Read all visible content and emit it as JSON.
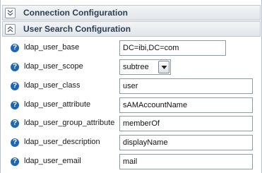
{
  "sections": {
    "connection": {
      "title": "Connection Configuration",
      "state": "collapsed",
      "icon": "chevron-double-down-icon"
    },
    "user_search": {
      "title": "User Search Configuration",
      "state": "expanded",
      "icon": "chevron-double-up-icon"
    }
  },
  "help_icon": {
    "glyph": "?",
    "name": "help-icon"
  },
  "fields": [
    {
      "label": "ldap_user_base",
      "value": "DC=ibi,DC=com"
    },
    {
      "label": "ldap_user_scope",
      "value": "subtree"
    },
    {
      "label": "ldap_user_class",
      "value": "user"
    },
    {
      "label": "ldap_user_attribute",
      "value": "sAMAccountName"
    },
    {
      "label": "ldap_user_group_attribute",
      "value": "memberOf"
    },
    {
      "label": "ldap_user_description",
      "value": "displayName"
    },
    {
      "label": "ldap_user_email",
      "value": "mail"
    }
  ],
  "colors": {
    "header_title": "#2a3e54",
    "help_icon": "#1f66b5",
    "input_border": "#8e9aa6"
  }
}
